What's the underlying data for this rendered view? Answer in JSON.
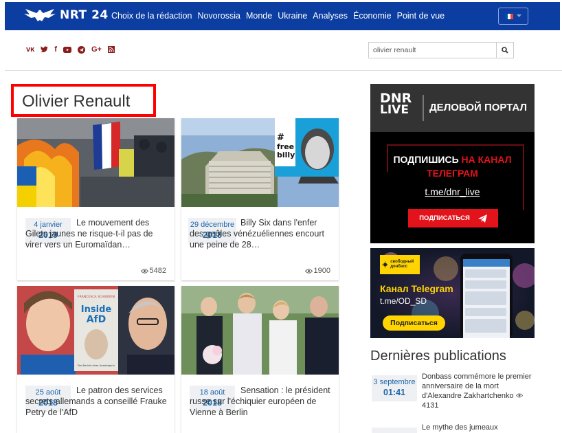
{
  "nav": {
    "logo_text": "NRT 24",
    "menu": [
      "Choix de la rédaction",
      "Novorossia",
      "Monde",
      "Ukraine",
      "Analyses",
      "Économie",
      "Point de vue"
    ],
    "language": {
      "flag_colors": [
        "#0055a4",
        "#ffffff",
        "#ef4135"
      ],
      "icon": "chevron-down-icon"
    }
  },
  "social_icons": [
    "vk-icon",
    "twitter-icon",
    "facebook-icon",
    "youtube-icon",
    "telegram-icon",
    "google-plus-icon",
    "rss-icon"
  ],
  "search": {
    "value": "olivier renault",
    "button_icon": "search-icon"
  },
  "page_title": "Olivier Renault",
  "articles": [
    {
      "day": "4 janvier",
      "year": "2019",
      "title": "Le mouvement des Gilets jaunes ne risque-t-il pas de virer vers un Euromaïdan…",
      "views": "5482"
    },
    {
      "day": "29 décembre",
      "year": "2018",
      "title": "Billy Six dans l'enfer des geôles vénézuéliennes encourt une peine de 28…",
      "views": "1900",
      "image_text": [
        "#",
        "free",
        "billy"
      ]
    },
    {
      "day": "25 août",
      "year": "2018",
      "title": "Le patron des services secrets allemands a conseillé Frauke Petry de l'AfD",
      "image_text": {
        "author": "FRANCESCA SCHWERIN",
        "book_title": [
          "Inside",
          "AfD"
        ],
        "subtitle": "Der Bericht einer Aussteigerin"
      }
    },
    {
      "day": "18 août",
      "year": "2018",
      "title": "Sensation : le président russe sur l'échiquier européen de Vienne à Berlin"
    }
  ],
  "ad1": {
    "logo_top": "DNR",
    "logo_bottom": "LIVE",
    "header": "ДЕЛОВОЙ ПОРТАЛ",
    "line1_white": "ПОДПИШИСЬ",
    "line1_red": "НА КАНАЛ",
    "line2": "ТЕЛЕГРАМ",
    "link": "t.me/dnr_live",
    "button": "ПОДПИСАТЬСЯ",
    "colors": {
      "accent": "#e3131b"
    }
  },
  "ad2": {
    "brand": "свободный донбасс",
    "title": "Канал Telegram",
    "link": "t.me/OD_SD",
    "button": "Подписаться",
    "colors": {
      "accent": "#ffd400"
    }
  },
  "latest": {
    "title": "Dernières publications",
    "items": [
      {
        "day": "3 septembre",
        "time": "01:41",
        "title": "Donbass commémore le premier anniversaire de la mort d'Alexandre Zakhartchenko",
        "views": "4131"
      },
      {
        "title": "Le mythe des jumeaux"
      }
    ]
  }
}
